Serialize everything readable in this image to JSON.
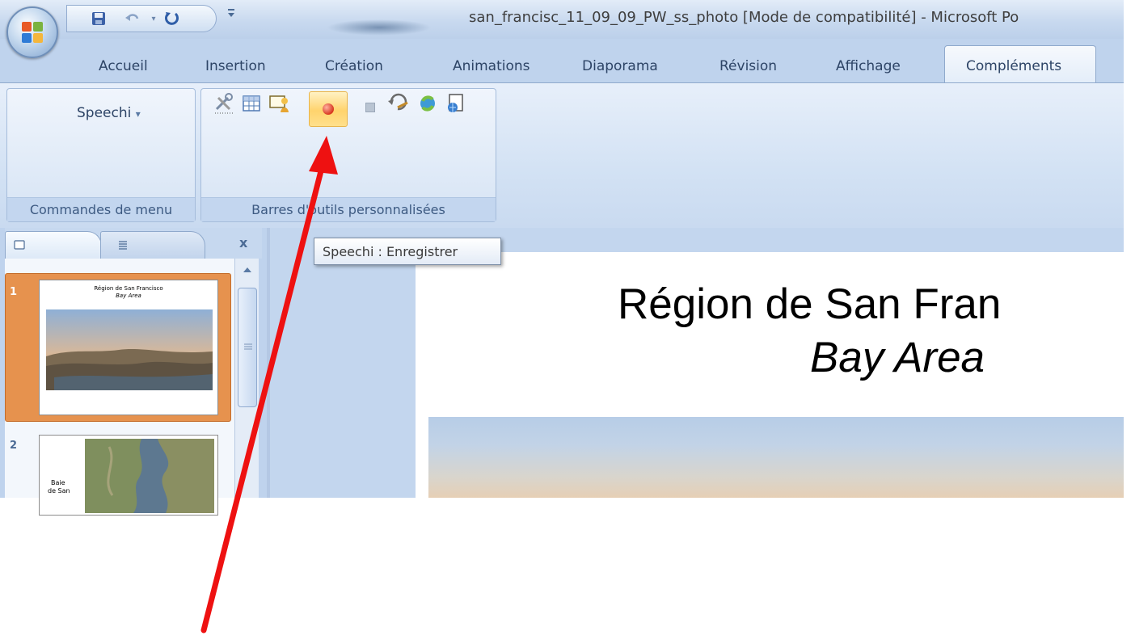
{
  "window": {
    "title": "san_francisc_11_09_09_PW_ss_photo [Mode de compatibilité] - Microsoft Po"
  },
  "quick_access": {
    "save_icon": "save-icon",
    "undo_icon": "undo-icon",
    "redo_icon": "redo-icon",
    "customize_icon": "customize-qat-icon"
  },
  "tabs": {
    "accueil": "Accueil",
    "insertion": "Insertion",
    "creation": "Création",
    "animations": "Animations",
    "diaporama": "Diaporama",
    "revision": "Révision",
    "affichage": "Affichage",
    "complements": "Compléments"
  },
  "ribbon": {
    "menu_commands": {
      "speechi_label": "Speechi",
      "dropdown_glyph": "▾",
      "group_label": "Commandes de menu"
    },
    "custom_toolbars": {
      "group_label": "Barres d'outils personnalisées"
    }
  },
  "panes": {
    "close_label": "x",
    "slide_1_number": "1",
    "slide_1_title": "Région de San Francisco",
    "slide_1_subtitle": "Bay Area",
    "slide_2_number": "2",
    "slide_2_text_line1": "Baie",
    "slide_2_text_line2": "de San"
  },
  "tooltip": {
    "text": "Speechi : Enregistrer"
  },
  "slide": {
    "title": "Région de San Fran",
    "subtitle": "Bay Area"
  },
  "colors": {
    "arrow": "#ee1111",
    "active_record": "#ffd36d",
    "ribbon": "#d3e2f4"
  }
}
